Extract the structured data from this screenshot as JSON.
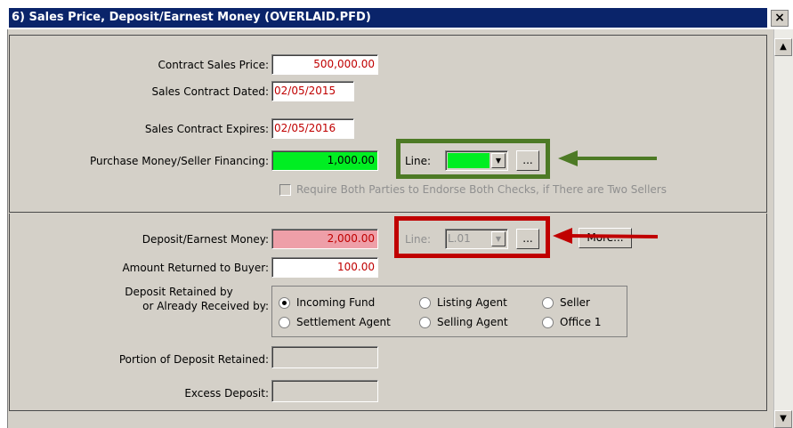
{
  "window": {
    "title": "6) Sales Price, Deposit/Earnest Money (OVERLAID.PFD)",
    "close_symbol": "×"
  },
  "scrollbar": {
    "up": "▲",
    "down": "▼"
  },
  "section1": {
    "contract_sales_price": {
      "label": "Contract Sales Price:",
      "value": "500,000.00"
    },
    "sales_contract_dated": {
      "label": "Sales Contract Dated:",
      "value": "02/05/2015"
    },
    "sales_contract_expires": {
      "label": "Sales Contract Expires:",
      "value": "02/05/2016"
    },
    "purchase_money": {
      "label": "Purchase Money/Seller Financing:",
      "value": "1,000.00"
    },
    "line": {
      "label": "Line:",
      "value": "",
      "ellipsis": "..."
    },
    "require_both": {
      "label": "Require Both Parties to Endorse Both Checks, if There are Two Sellers",
      "checked": false
    }
  },
  "section2": {
    "deposit": {
      "label": "Deposit/Earnest Money:",
      "value": "2,000.00"
    },
    "line": {
      "label": "Line:",
      "value": "L.01",
      "ellipsis": "..."
    },
    "more_button": "More...",
    "amount_returned": {
      "label": "Amount Returned to Buyer:",
      "value": "100.00"
    },
    "deposit_retained": {
      "label_line1": "Deposit Retained by",
      "label_line2": "or Already Received by:",
      "options": [
        {
          "label": "Incoming Fund",
          "selected": true
        },
        {
          "label": "Listing Agent",
          "selected": false
        },
        {
          "label": "Seller",
          "selected": false
        },
        {
          "label": "Settlement Agent",
          "selected": false
        },
        {
          "label": "Selling Agent",
          "selected": false
        },
        {
          "label": "Office 1",
          "selected": false
        }
      ]
    },
    "portion_retained": {
      "label": "Portion of Deposit Retained:",
      "value": ""
    },
    "excess_deposit": {
      "label": "Excess Deposit:",
      "value": ""
    }
  },
  "annotations": {
    "green_color": "#4d7a25",
    "red_color": "#c00000"
  }
}
